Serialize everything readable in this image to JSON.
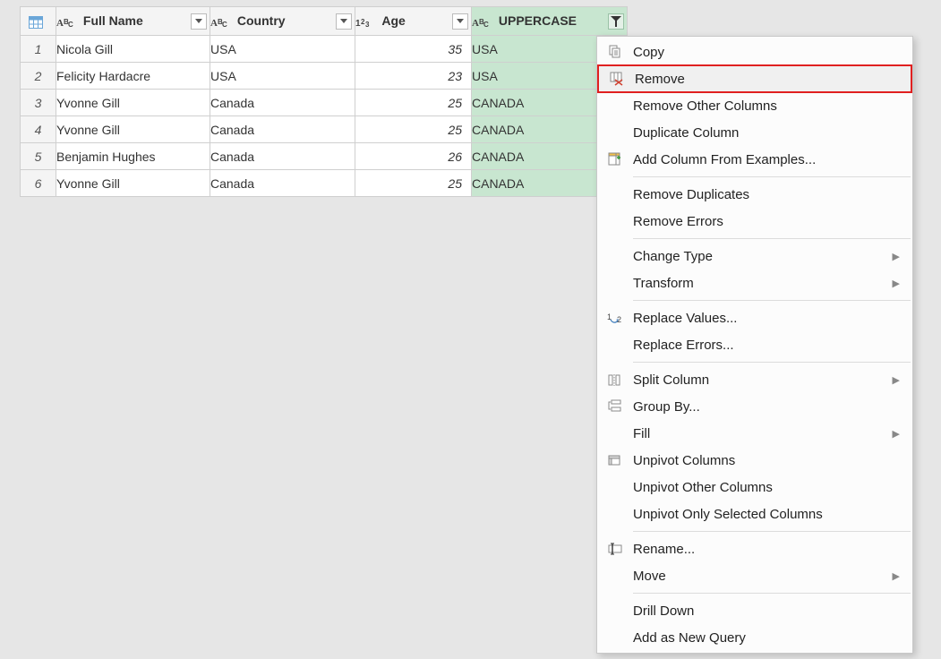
{
  "columns": {
    "fullname": {
      "label": "Full Name",
      "type": "text"
    },
    "country": {
      "label": "Country",
      "type": "text"
    },
    "age": {
      "label": "Age",
      "type": "number"
    },
    "upper": {
      "label": "UPPERCASE",
      "type": "text",
      "selected": true,
      "filtered": true
    }
  },
  "rows": [
    {
      "n": "1",
      "fullname": "Nicola Gill",
      "country": "USA",
      "age": "35",
      "upper": "USA"
    },
    {
      "n": "2",
      "fullname": "Felicity Hardacre",
      "country": "USA",
      "age": "23",
      "upper": "USA"
    },
    {
      "n": "3",
      "fullname": "Yvonne Gill",
      "country": "Canada",
      "age": "25",
      "upper": "CANADA"
    },
    {
      "n": "4",
      "fullname": "Yvonne Gill",
      "country": "Canada",
      "age": "25",
      "upper": "CANADA"
    },
    {
      "n": "5",
      "fullname": "Benjamin Hughes",
      "country": "Canada",
      "age": "26",
      "upper": "CANADA"
    },
    {
      "n": "6",
      "fullname": "Yvonne Gill",
      "country": "Canada",
      "age": "25",
      "upper": "CANADA"
    }
  ],
  "menu": {
    "copy": "Copy",
    "remove": "Remove",
    "remove_other": "Remove Other Columns",
    "duplicate": "Duplicate Column",
    "add_from_examples": "Add Column From Examples...",
    "remove_dup": "Remove Duplicates",
    "remove_err": "Remove Errors",
    "change_type": "Change Type",
    "transform": "Transform",
    "replace_values": "Replace Values...",
    "replace_errors": "Replace Errors...",
    "split_column": "Split Column",
    "group_by": "Group By...",
    "fill": "Fill",
    "unpivot": "Unpivot Columns",
    "unpivot_other": "Unpivot Other Columns",
    "unpivot_selected": "Unpivot Only Selected Columns",
    "rename": "Rename...",
    "move": "Move",
    "drill_down": "Drill Down",
    "add_new_query": "Add as New Query"
  }
}
